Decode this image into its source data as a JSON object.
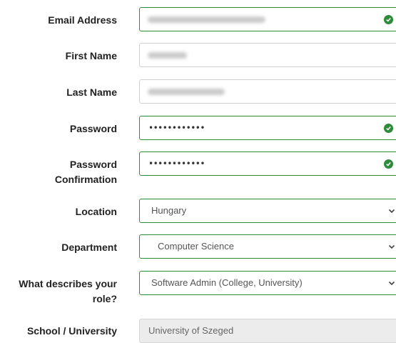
{
  "form": {
    "email": {
      "label": "Email Address"
    },
    "first_name": {
      "label": "First Name"
    },
    "last_name": {
      "label": "Last Name"
    },
    "password": {
      "label": "Password",
      "value": "••••••••••••"
    },
    "password_confirmation": {
      "label_line1": "Password",
      "label_line2": "Confirmation",
      "value": "••••••••••••"
    },
    "location": {
      "label": "Location",
      "value": "Hungary"
    },
    "department": {
      "label": "Department",
      "value": "Computer Science"
    },
    "role": {
      "label_line1": "What describes your",
      "label_line2": "role?",
      "value": "Software Admin (College, University)"
    },
    "school": {
      "label": "School / University",
      "value": "University of Szeged"
    }
  },
  "colors": {
    "valid": "#2e8b3a",
    "border": "#cfcfcf",
    "disabled_bg": "#ececec"
  },
  "icons": {
    "valid": "check-circle-icon",
    "dropdown": "chevron-down-icon"
  }
}
